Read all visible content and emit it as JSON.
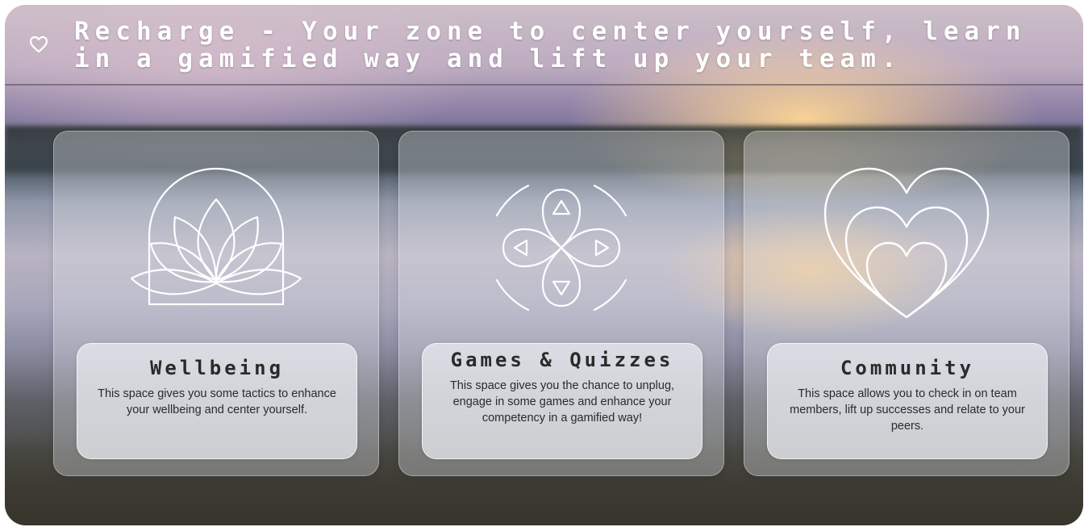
{
  "header": {
    "title": "Recharge - Your zone to center yourself, learn in a gamified way and lift up your team.",
    "icon": "heart-outline-icon"
  },
  "cards": [
    {
      "title": "Wellbeing",
      "description": "This space gives you some tactics to enhance your wellbeing and center yourself.",
      "icon": "lotus-icon"
    },
    {
      "title": "Games & Quizzes",
      "description": "This space gives you the chance to unplug, engage in some games and enhance your competency in a gamified way!",
      "icon": "gamepad-dpad-icon"
    },
    {
      "title": "Community",
      "description": "This space allows you to check in on team members, lift up successes and relate to your peers.",
      "icon": "nested-hearts-icon"
    }
  ],
  "colors": {
    "text_light": "#ffffff",
    "text_dark": "#2a2a2a",
    "card_glass": "rgba(225,228,235,0.35)"
  }
}
